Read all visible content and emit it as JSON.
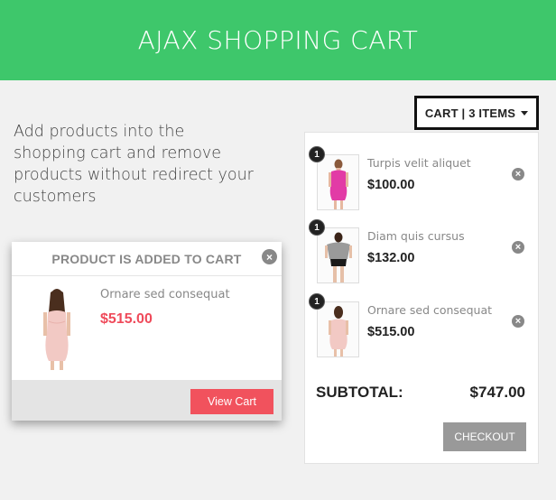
{
  "header": {
    "title": "AJAX SHOPPING CART"
  },
  "intro": {
    "text": "Add products into the shopping cart and remove products without redirect your customers"
  },
  "cart_toggle": {
    "label": "CART | 3 ITEMS"
  },
  "cart": {
    "items": [
      {
        "qty": "1",
        "name": "Turpis velit aliquet",
        "price": "$100.00",
        "remove_icon": "close-circle-icon",
        "image": "woman-pink-dress"
      },
      {
        "qty": "1",
        "name": "Diam quis cursus",
        "price": "$132.00",
        "remove_icon": "close-circle-icon",
        "image": "woman-grey-top-black-shorts"
      },
      {
        "qty": "1",
        "name": "Ornare sed consequat",
        "price": "$515.00",
        "remove_icon": "close-circle-icon",
        "image": "woman-light-pink-dress"
      }
    ],
    "subtotal_label": "SUBTOTAL:",
    "subtotal_value": "$747.00",
    "checkout_label": "CHECKOUT"
  },
  "popup": {
    "title": "PRODUCT IS ADDED TO CART",
    "close_icon": "close-circle-icon",
    "product_name": "Ornare sed consequat",
    "product_price": "$515.00",
    "view_cart_label": "View Cart"
  },
  "colors": {
    "header_green": "#3ec76b",
    "price_red": "#ef4a5a",
    "view_cart_button": "#f1525d",
    "checkout_button": "#999999"
  }
}
